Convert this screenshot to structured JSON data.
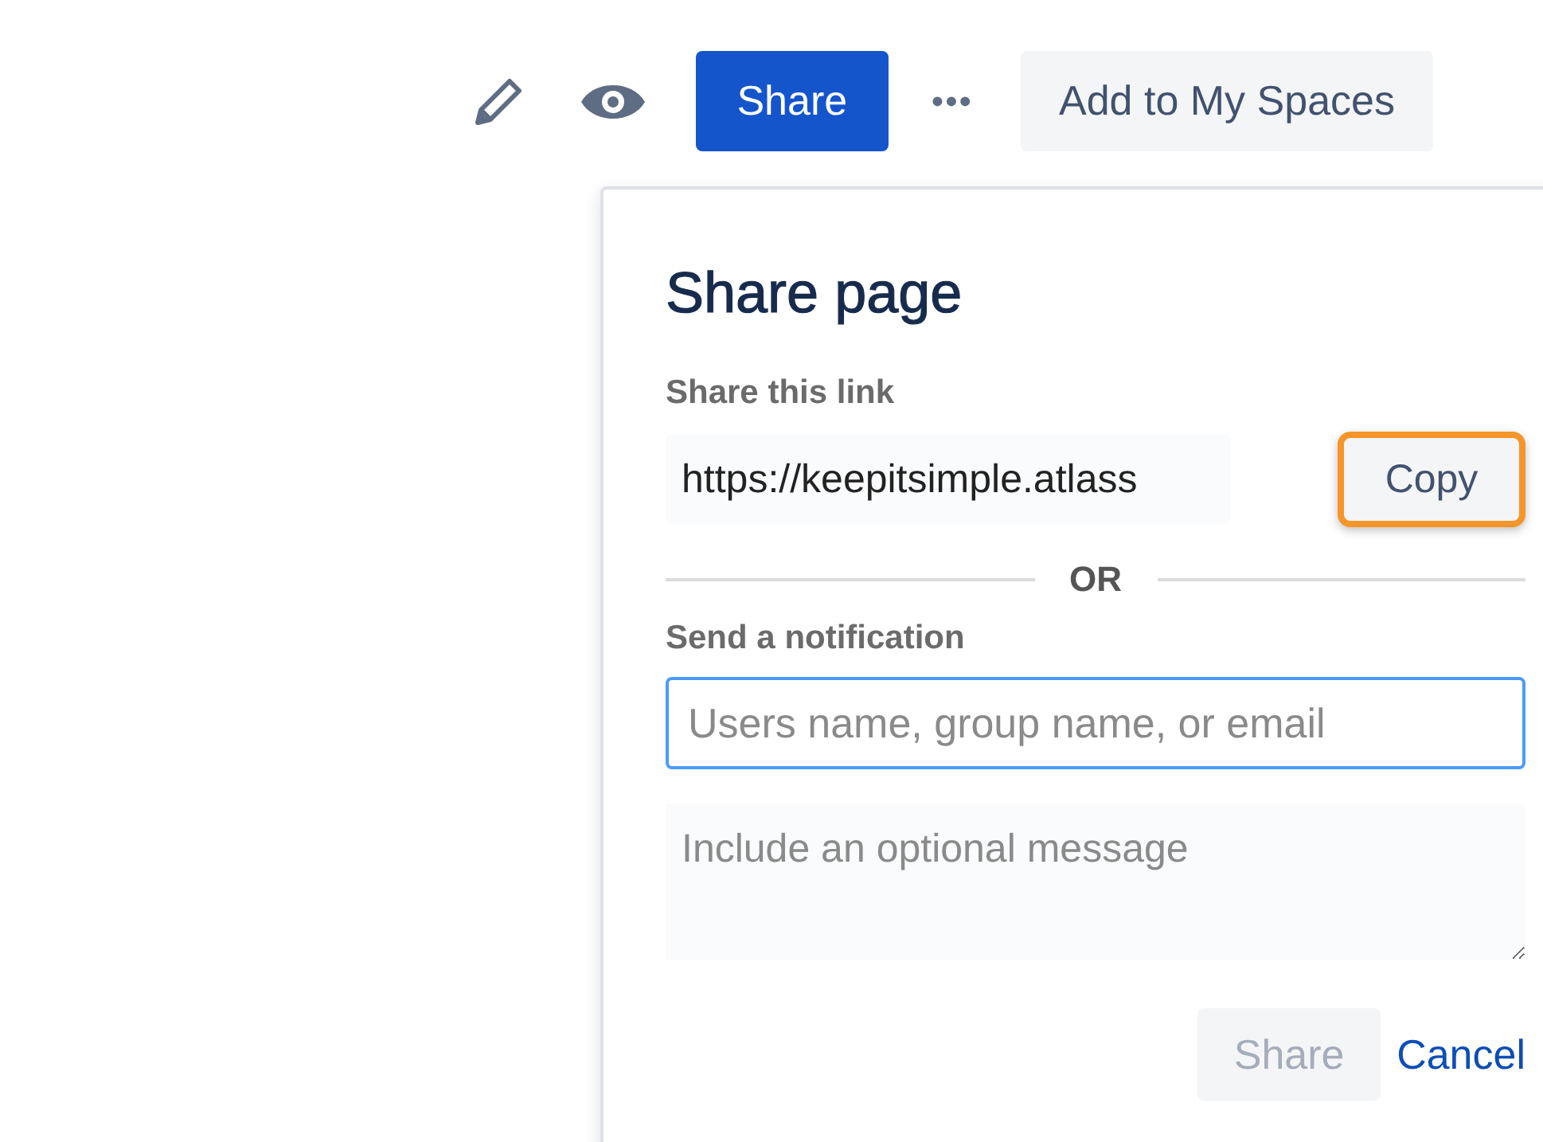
{
  "toolbar": {
    "share_button": "Share",
    "more_button": "•••",
    "add_button": "Add to My Spaces"
  },
  "dialog": {
    "title": "Share page",
    "link_label": "Share this link",
    "link_value": "https://keepitsimple.atlass",
    "copy_button": {
      "label": "Copy",
      "highlighted": true
    },
    "divider": "OR",
    "notification_label": "Send a notification",
    "recipient_field": {
      "placeholder": "Users name, group name, or email",
      "focused": true
    },
    "message_field": {
      "placeholder": "Include an optional message"
    },
    "share_button": {
      "label": "Share",
      "disabled": true
    },
    "cancel_link": "Cancel"
  }
}
